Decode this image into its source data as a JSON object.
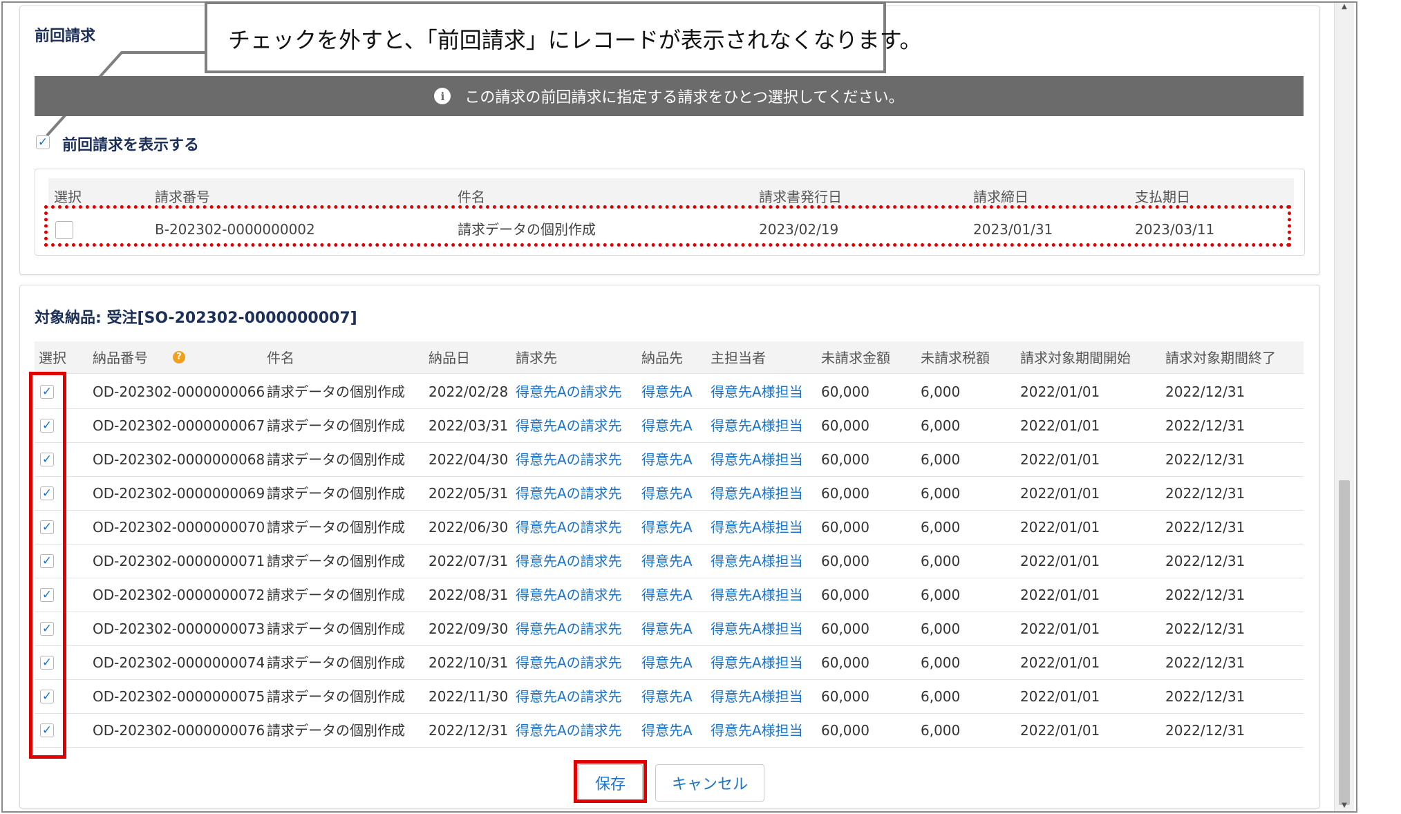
{
  "callout_text": "チェックを外すと、「前回請求」にレコードが表示されなくなります。",
  "prev_section": {
    "title": "前回請求",
    "banner_text": "この請求の前回請求に指定する請求をひとつ選択してください。",
    "toggle_label": "前回請求を表示する",
    "toggle_checked": true,
    "columns": [
      "選択",
      "請求番号",
      "件名",
      "請求書発行日",
      "請求締日",
      "支払期日"
    ],
    "row": {
      "selected": false,
      "number": "B-202302-0000000002",
      "subject": "請求データの個別作成",
      "issue_date": "2023/02/19",
      "closing_date": "2023/01/31",
      "due_date": "2023/03/11"
    }
  },
  "delivery_section": {
    "title": "対象納品: 受注[SO-202302-0000000007]",
    "columns": [
      "選択",
      "納品番号",
      "件名",
      "納品日",
      "請求先",
      "納品先",
      "主担当者",
      "未請求金額",
      "未請求税額",
      "請求対象期間開始",
      "請求対象期間終了"
    ],
    "rows": [
      {
        "checked": true,
        "number": "OD-202302-0000000066",
        "subject": "請求データの個別作成",
        "date": "2022/02/28",
        "bill_to": "得意先Aの請求先",
        "ship_to": "得意先A",
        "owner": "得意先A様担当",
        "amount": "60,000",
        "tax": "6,000",
        "start": "2022/01/01",
        "end": "2022/12/31"
      },
      {
        "checked": true,
        "number": "OD-202302-0000000067",
        "subject": "請求データの個別作成",
        "date": "2022/03/31",
        "bill_to": "得意先Aの請求先",
        "ship_to": "得意先A",
        "owner": "得意先A様担当",
        "amount": "60,000",
        "tax": "6,000",
        "start": "2022/01/01",
        "end": "2022/12/31"
      },
      {
        "checked": true,
        "number": "OD-202302-0000000068",
        "subject": "請求データの個別作成",
        "date": "2022/04/30",
        "bill_to": "得意先Aの請求先",
        "ship_to": "得意先A",
        "owner": "得意先A様担当",
        "amount": "60,000",
        "tax": "6,000",
        "start": "2022/01/01",
        "end": "2022/12/31"
      },
      {
        "checked": true,
        "number": "OD-202302-0000000069",
        "subject": "請求データの個別作成",
        "date": "2022/05/31",
        "bill_to": "得意先Aの請求先",
        "ship_to": "得意先A",
        "owner": "得意先A様担当",
        "amount": "60,000",
        "tax": "6,000",
        "start": "2022/01/01",
        "end": "2022/12/31"
      },
      {
        "checked": true,
        "number": "OD-202302-0000000070",
        "subject": "請求データの個別作成",
        "date": "2022/06/30",
        "bill_to": "得意先Aの請求先",
        "ship_to": "得意先A",
        "owner": "得意先A様担当",
        "amount": "60,000",
        "tax": "6,000",
        "start": "2022/01/01",
        "end": "2022/12/31"
      },
      {
        "checked": true,
        "number": "OD-202302-0000000071",
        "subject": "請求データの個別作成",
        "date": "2022/07/31",
        "bill_to": "得意先Aの請求先",
        "ship_to": "得意先A",
        "owner": "得意先A様担当",
        "amount": "60,000",
        "tax": "6,000",
        "start": "2022/01/01",
        "end": "2022/12/31"
      },
      {
        "checked": true,
        "number": "OD-202302-0000000072",
        "subject": "請求データの個別作成",
        "date": "2022/08/31",
        "bill_to": "得意先Aの請求先",
        "ship_to": "得意先A",
        "owner": "得意先A様担当",
        "amount": "60,000",
        "tax": "6,000",
        "start": "2022/01/01",
        "end": "2022/12/31"
      },
      {
        "checked": true,
        "number": "OD-202302-0000000073",
        "subject": "請求データの個別作成",
        "date": "2022/09/30",
        "bill_to": "得意先Aの請求先",
        "ship_to": "得意先A",
        "owner": "得意先A様担当",
        "amount": "60,000",
        "tax": "6,000",
        "start": "2022/01/01",
        "end": "2022/12/31"
      },
      {
        "checked": true,
        "number": "OD-202302-0000000074",
        "subject": "請求データの個別作成",
        "date": "2022/10/31",
        "bill_to": "得意先Aの請求先",
        "ship_to": "得意先A",
        "owner": "得意先A様担当",
        "amount": "60,000",
        "tax": "6,000",
        "start": "2022/01/01",
        "end": "2022/12/31"
      },
      {
        "checked": true,
        "number": "OD-202302-0000000075",
        "subject": "請求データの個別作成",
        "date": "2022/11/30",
        "bill_to": "得意先Aの請求先",
        "ship_to": "得意先A",
        "owner": "得意先A様担当",
        "amount": "60,000",
        "tax": "6,000",
        "start": "2022/01/01",
        "end": "2022/12/31"
      },
      {
        "checked": true,
        "number": "OD-202302-0000000076",
        "subject": "請求データの個別作成",
        "date": "2022/12/31",
        "bill_to": "得意先Aの請求先",
        "ship_to": "得意先A",
        "owner": "得意先A様担当",
        "amount": "60,000",
        "tax": "6,000",
        "start": "2022/01/01",
        "end": "2022/12/31"
      }
    ]
  },
  "buttons": {
    "save": "保存",
    "cancel": "キャンセル"
  },
  "colors": {
    "accent": "#1a73c9",
    "banner": "#6b6b6b",
    "highlight": "#e00000",
    "title": "#1b2f58"
  },
  "icons": {
    "info": "info-icon",
    "help": "help-icon",
    "check": "checkmark-icon"
  }
}
